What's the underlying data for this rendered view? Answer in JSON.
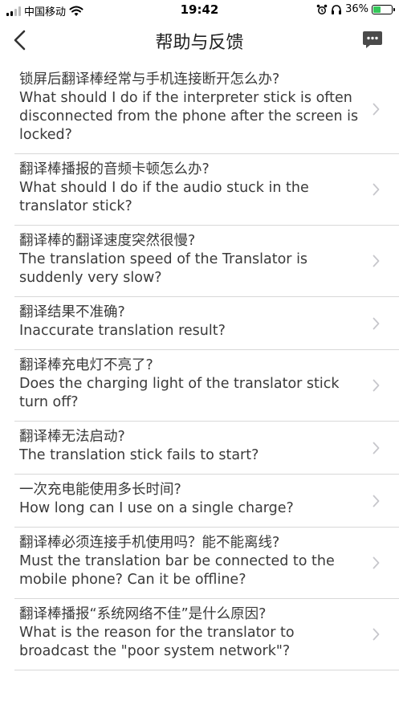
{
  "status_bar": {
    "carrier": "中国移动",
    "time": "19:42",
    "battery_percent": "36%",
    "battery_level": 0.36,
    "icons": [
      "signal-icon",
      "wifi-icon",
      "alarm-icon",
      "headphones-icon",
      "battery-icon"
    ]
  },
  "nav": {
    "title": "帮助与反馈",
    "back_icon": "chevron-left-icon",
    "chat_icon": "chat-bubble-icon"
  },
  "faq": {
    "items": [
      {
        "zh": "锁屏后翻译棒经常与手机连接断开怎么办?",
        "en": "What should I do if the interpreter stick is often disconnected from the phone after the screen is locked?"
      },
      {
        "zh": "翻译棒播报的音频卡顿怎么办?",
        "en": "What should I do if the audio stuck in the translator stick?"
      },
      {
        "zh": "翻译棒的翻译速度突然很慢?",
        "en": "The translation speed of the Translator is suddenly very slow?"
      },
      {
        "zh": "翻译结果不准确?",
        "en": "Inaccurate translation result?"
      },
      {
        "zh": "翻译棒充电灯不亮了?",
        "en": "Does the charging light of the translator stick turn off?"
      },
      {
        "zh": "翻译棒无法启动?",
        "en": "The translation stick fails to start?"
      },
      {
        "zh": "一次充电能使用多长时间?",
        "en": "How long can I use on a single charge?"
      },
      {
        "zh": "翻译棒必须连接手机使用吗？能不能离线?",
        "en": "Must the translation bar be connected to the mobile phone? Can it be offline?"
      },
      {
        "zh": "翻译棒播报“系统网络不佳”是什么原因?",
        "en": "What is the reason for the translator to broadcast the \"poor system network\"?"
      }
    ]
  },
  "colors": {
    "text": "#3a3a3a",
    "divider": "#d8d8d8",
    "chevron": "#c7c7cc",
    "chat_icon": "#4a4a4a",
    "battery_fill": "#34c759"
  }
}
